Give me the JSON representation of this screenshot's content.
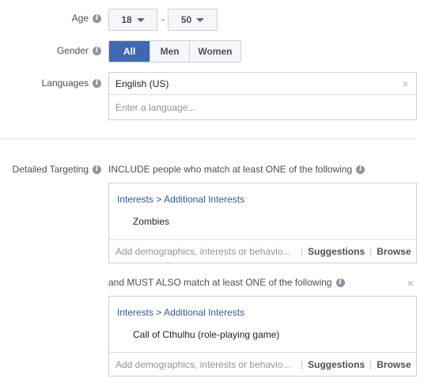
{
  "age": {
    "label": "Age",
    "min": "18",
    "separator": "-",
    "max": "50"
  },
  "gender": {
    "label": "Gender",
    "options": [
      "All",
      "Men",
      "Women"
    ],
    "selected": "All"
  },
  "languages": {
    "label": "Languages",
    "selected": "English (US)",
    "remove": "×",
    "placeholder": "Enter a language..."
  },
  "detailed_targeting": {
    "label": "Detailed Targeting",
    "include_heading": "INCLUDE people who match at least ONE of the following",
    "include": {
      "crumb_parent": "Interests",
      "crumb_sep": ">",
      "crumb_child": "Additional Interests",
      "item": "Zombies",
      "placeholder": "Add demographics, interests or behavio...",
      "divider": "|",
      "suggestions": "Suggestions",
      "browse": "Browse"
    },
    "must_heading": "and MUST ALSO match at least ONE of the following",
    "must_remove": "×",
    "must": {
      "crumb_parent": "Interests",
      "crumb_sep": ">",
      "crumb_child": "Additional Interests",
      "item": "Call of Cthulhu (role-playing game)",
      "placeholder": "Add demographics, interests or behavio...",
      "divider": "|",
      "suggestions": "Suggestions",
      "browse": "Browse"
    }
  },
  "colors": {
    "accent": "#4267b2",
    "link": "#365899",
    "border": "#ccd0d5"
  }
}
